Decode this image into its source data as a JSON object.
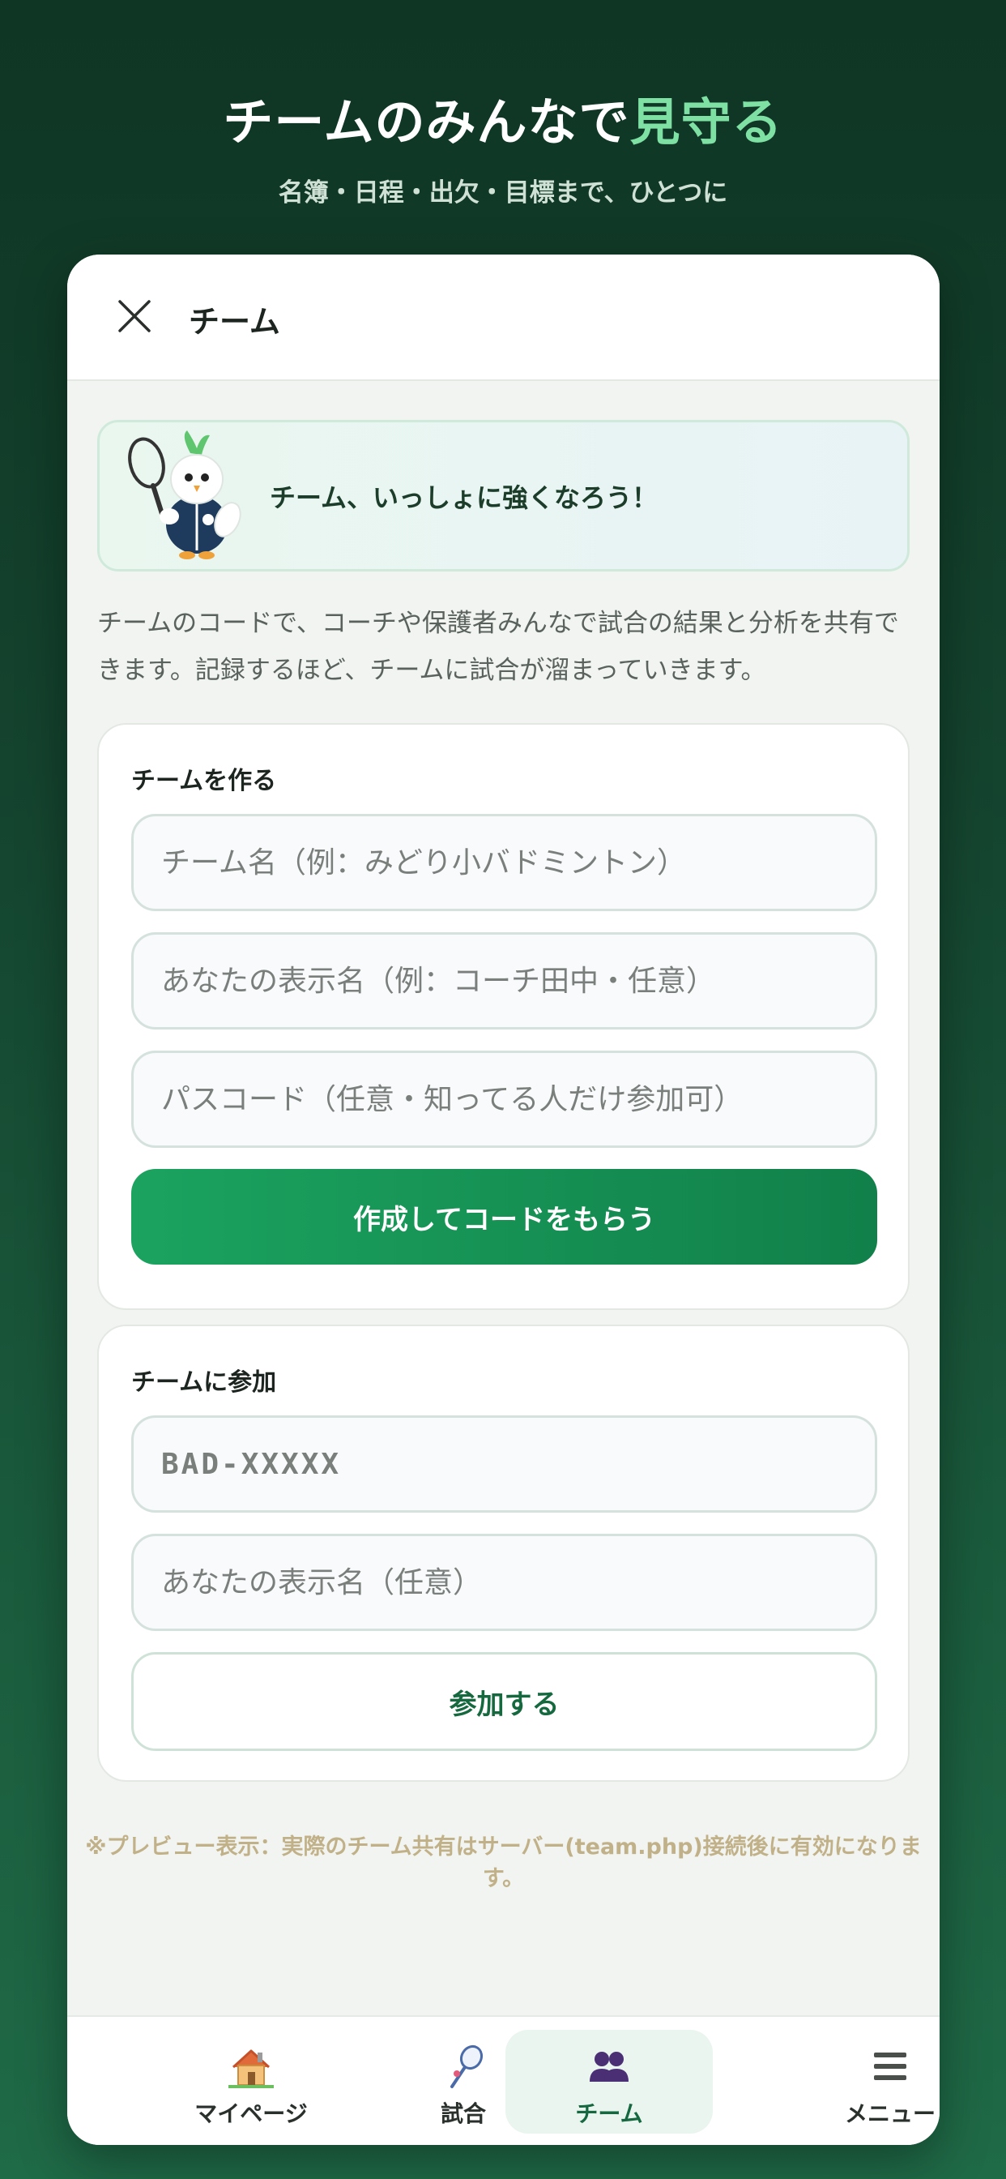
{
  "hero": {
    "title_main": "チームのみんなで",
    "title_accent": "見守る",
    "subtitle": "名簿・日程・出欠・目標まで、ひとつに"
  },
  "header": {
    "close_icon": "close-icon",
    "title": "チーム"
  },
  "banner": {
    "mascot_icon": "bird-mascot-with-racket",
    "text": "チーム、いっしょに強くなろう！"
  },
  "description": "チームのコードで、コーチや保護者みんなで試合の結果と分析を共有できます。記録するほど、チームに試合が溜まっていきます。",
  "create_team": {
    "label": "チームを作る",
    "team_name_placeholder": "チーム名（例：みどり小バドミントン）",
    "display_name_placeholder": "あなたの表示名（例：コーチ田中・任意）",
    "passcode_placeholder": "パスコード（任意・知ってる人だけ参加可）",
    "submit_label": "作成してコードをもらう"
  },
  "join_team": {
    "label": "チームに参加",
    "code_placeholder": "BAD-XXXXX",
    "display_name_placeholder": "あなたの表示名（任意）",
    "submit_label": "参加する"
  },
  "note": "※プレビュー表示：実際のチーム共有はサーバー(team.php)接続後に有効になります。",
  "tabs": [
    {
      "label": "マイページ",
      "icon": "house-icon",
      "active": false
    },
    {
      "label": "試合",
      "icon": "badminton-racket-icon",
      "active": false
    },
    {
      "label": "チーム",
      "icon": "people-icon",
      "active": true
    },
    {
      "label": "メニュー",
      "icon": "hamburger-menu-icon",
      "active": false
    }
  ],
  "colors": {
    "brand_green": "#16a35e",
    "accent_light_green": "#7fe0a4",
    "active_tab_bg": "#e9f5ee"
  }
}
